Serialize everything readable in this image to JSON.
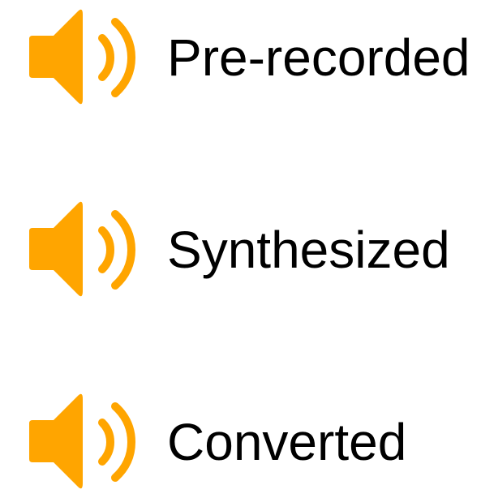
{
  "accent_color": "#FFA500",
  "audio_items": [
    {
      "label": "Pre-recorded",
      "icon": "speaker-volume-icon"
    },
    {
      "label": "Synthesized",
      "icon": "speaker-volume-icon"
    },
    {
      "label": "Converted",
      "icon": "speaker-volume-icon"
    }
  ]
}
